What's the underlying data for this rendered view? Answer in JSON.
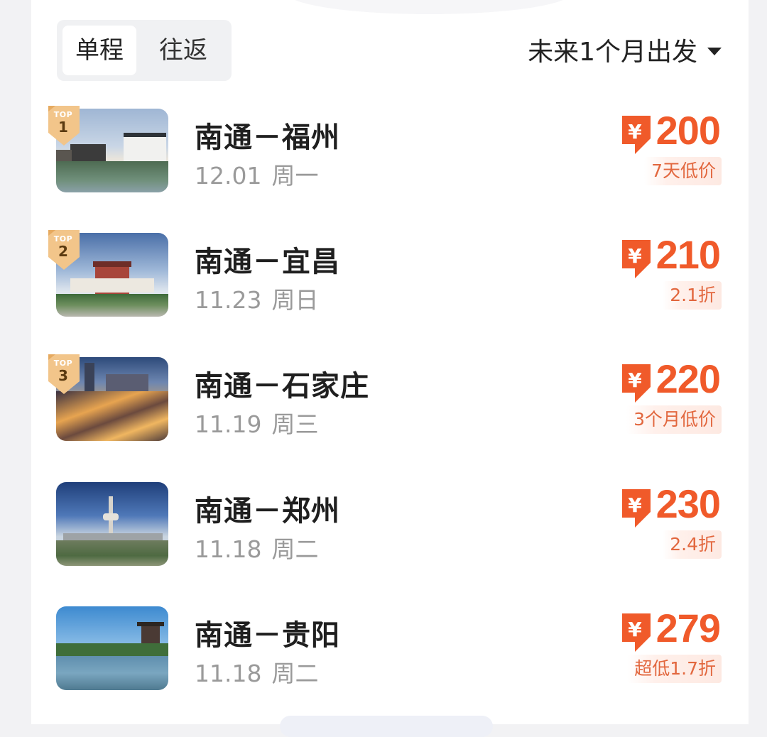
{
  "trip_tabs": {
    "one_way": "单程",
    "round_trip": "往返",
    "active": "单程"
  },
  "date_filter": {
    "label": "未来1个月出发"
  },
  "colors": {
    "price": "#f05a2a",
    "badge": "#f2c58a"
  },
  "routes": [
    {
      "rank": "1",
      "badge_label": "TOP",
      "route": "南通－福州",
      "date": "12.01",
      "weekday": "周一",
      "price": "200",
      "currency": "¥",
      "tag": "7天低价",
      "scene": "canal-town"
    },
    {
      "rank": "2",
      "badge_label": "TOP",
      "route": "南通－宜昌",
      "date": "11.23",
      "weekday": "周日",
      "price": "210",
      "currency": "¥",
      "tag": "2.1折",
      "scene": "temple-gate"
    },
    {
      "rank": "3",
      "badge_label": "TOP",
      "route": "南通－石家庄",
      "date": "11.19",
      "weekday": "周三",
      "price": "220",
      "currency": "¥",
      "tag": "3个月低价",
      "scene": "city-night"
    },
    {
      "rank": "",
      "badge_label": "",
      "route": "南通－郑州",
      "date": "11.18",
      "weekday": "周二",
      "price": "230",
      "currency": "¥",
      "tag": "2.4折",
      "scene": "tv-tower"
    },
    {
      "rank": "",
      "badge_label": "",
      "route": "南通－贵阳",
      "date": "11.18",
      "weekday": "周二",
      "price": "279",
      "currency": "¥",
      "tag": "超低1.7折",
      "scene": "river-pavilion"
    }
  ]
}
